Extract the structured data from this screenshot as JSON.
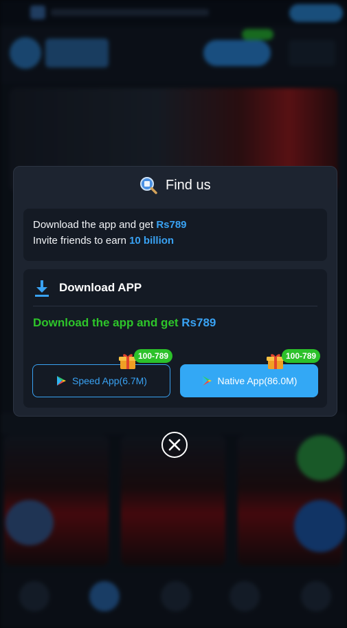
{
  "modal": {
    "title": "Find us",
    "title_icon": "magnifier-search-icon",
    "promo": {
      "line1_prefix": "Download the app and get ",
      "line1_highlight": "Rs789",
      "line2_prefix": "Invite friends to earn ",
      "line2_highlight": "10 billion"
    },
    "download": {
      "icon": "download-arrow-icon",
      "title": "Download APP",
      "subtitle_prefix": "Download the app and get ",
      "subtitle_highlight": "Rs789",
      "buttons": [
        {
          "label": "Speed App(6.7M)",
          "badge": "100-789",
          "icon": "google-play-icon",
          "badge_icon": "gift-box-icon",
          "style": "outline"
        },
        {
          "label": "Native App(86.0M)",
          "badge": "100-789",
          "icon": "google-play-icon",
          "badge_icon": "gift-box-icon",
          "style": "filled"
        }
      ]
    },
    "close_icon": "close-circle-icon"
  },
  "colors": {
    "accent_blue": "#39a2f3",
    "accent_green": "#2ec52a",
    "badge_green": "#2cc12a",
    "modal_bg": "#1d2430",
    "panel_bg": "#141a24"
  }
}
